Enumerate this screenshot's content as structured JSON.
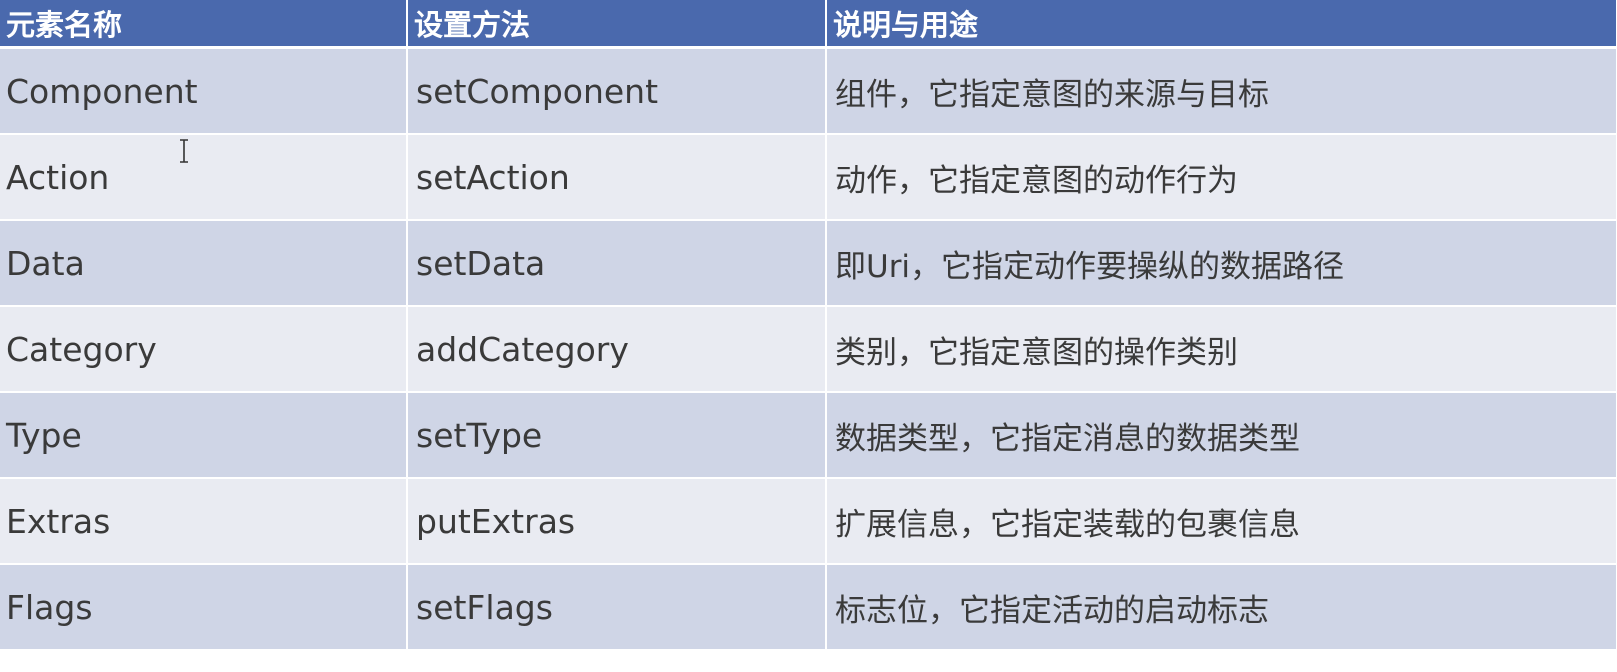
{
  "table": {
    "headers": [
      "元素名称",
      "设置方法",
      "说明与用途"
    ],
    "rows": [
      [
        "Component",
        "setComponent",
        "组件，它指定意图的来源与目标"
      ],
      [
        "Action",
        "setAction",
        "动作，它指定意图的动作行为"
      ],
      [
        "Data",
        "setData",
        "即Uri，它指定动作要操纵的数据路径"
      ],
      [
        "Category",
        "addCategory",
        "类别，它指定意图的操作类别"
      ],
      [
        "Type",
        "setType",
        "数据类型，它指定消息的数据类型"
      ],
      [
        "Extras",
        "putExtras",
        "扩展信息，它指定装载的包裹信息"
      ],
      [
        "Flags",
        "setFlags",
        "标志位，它指定活动的启动标志"
      ]
    ]
  },
  "colors": {
    "header_bg": "#4a69ad",
    "header_text": "#ffffff",
    "row_odd_bg": "#cfd5e6",
    "row_even_bg": "#e9ebf2",
    "cell_text": "#3a3a3a"
  },
  "cursor": {
    "icon": "text-cursor-icon"
  }
}
